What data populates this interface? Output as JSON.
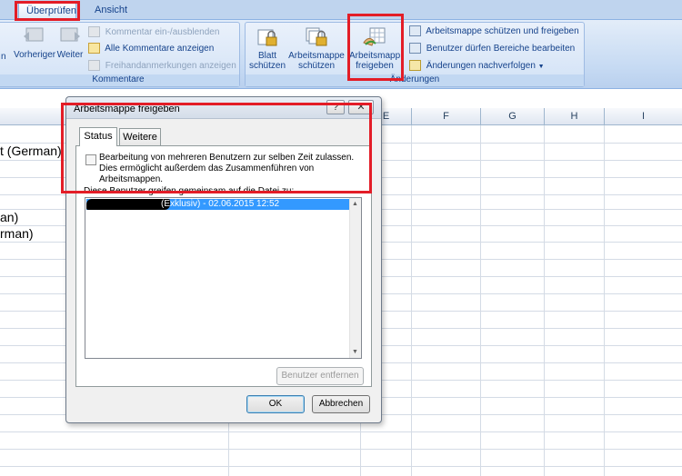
{
  "ribbon": {
    "tabs": [
      {
        "label": "Überprüfen",
        "active": true
      },
      {
        "label": "Ansicht",
        "active": false
      }
    ],
    "groups": {
      "comments": {
        "title": "Kommentare",
        "partial_left_label": "n",
        "prev_label": "Vorheriger",
        "next_label": "Weiter",
        "toggle_comment": "Kommentar ein-/ausblenden",
        "show_all": "Alle Kommentare anzeigen",
        "ink": "Freihandanmerkungen anzeigen"
      },
      "changes": {
        "title": "Änderungen",
        "protect_sheet_line1": "Blatt",
        "protect_sheet_line2": "schützen",
        "protect_workbook_line1": "Arbeitsmappe",
        "protect_workbook_line2": "schützen",
        "share_workbook_line1": "Arbeitsmapp",
        "share_workbook_line2": "freigeben",
        "protect_share": "Arbeitsmappe schützen und freigeben",
        "allow_ranges": "Benutzer dürfen Bereiche bearbeiten",
        "track_changes": "Änderungen nachverfolgen"
      }
    }
  },
  "sheet": {
    "columns": [
      "E",
      "F",
      "G",
      "H",
      "I"
    ],
    "cells": [
      "t (German)",
      "an)",
      "rman)"
    ]
  },
  "dialog": {
    "title": "Arbeitsmappe freigeben",
    "help_glyph": "?",
    "close_glyph": "✕",
    "tabs": [
      "Status",
      "Weitere"
    ],
    "checkbox_label": "Bearbeitung von mehreren Benutzern zur selben Zeit zulassen. Dies ermöglicht außerdem das Zusammenführen von Arbeitsmappen.",
    "checkbox_checked": false,
    "list_label": "Diese Benutzer greifen gemeinsam auf die Datei zu:",
    "users": [
      "(Exklusiv) - 02.06.2015 12:52"
    ],
    "remove_user_button": "Benutzer entfernen",
    "ok_button": "OK",
    "cancel_button": "Abbrechen"
  },
  "colors": {
    "annotation_red": "#e31d27",
    "ribbon_text": "#15428b",
    "selection_blue": "#3399ff"
  }
}
